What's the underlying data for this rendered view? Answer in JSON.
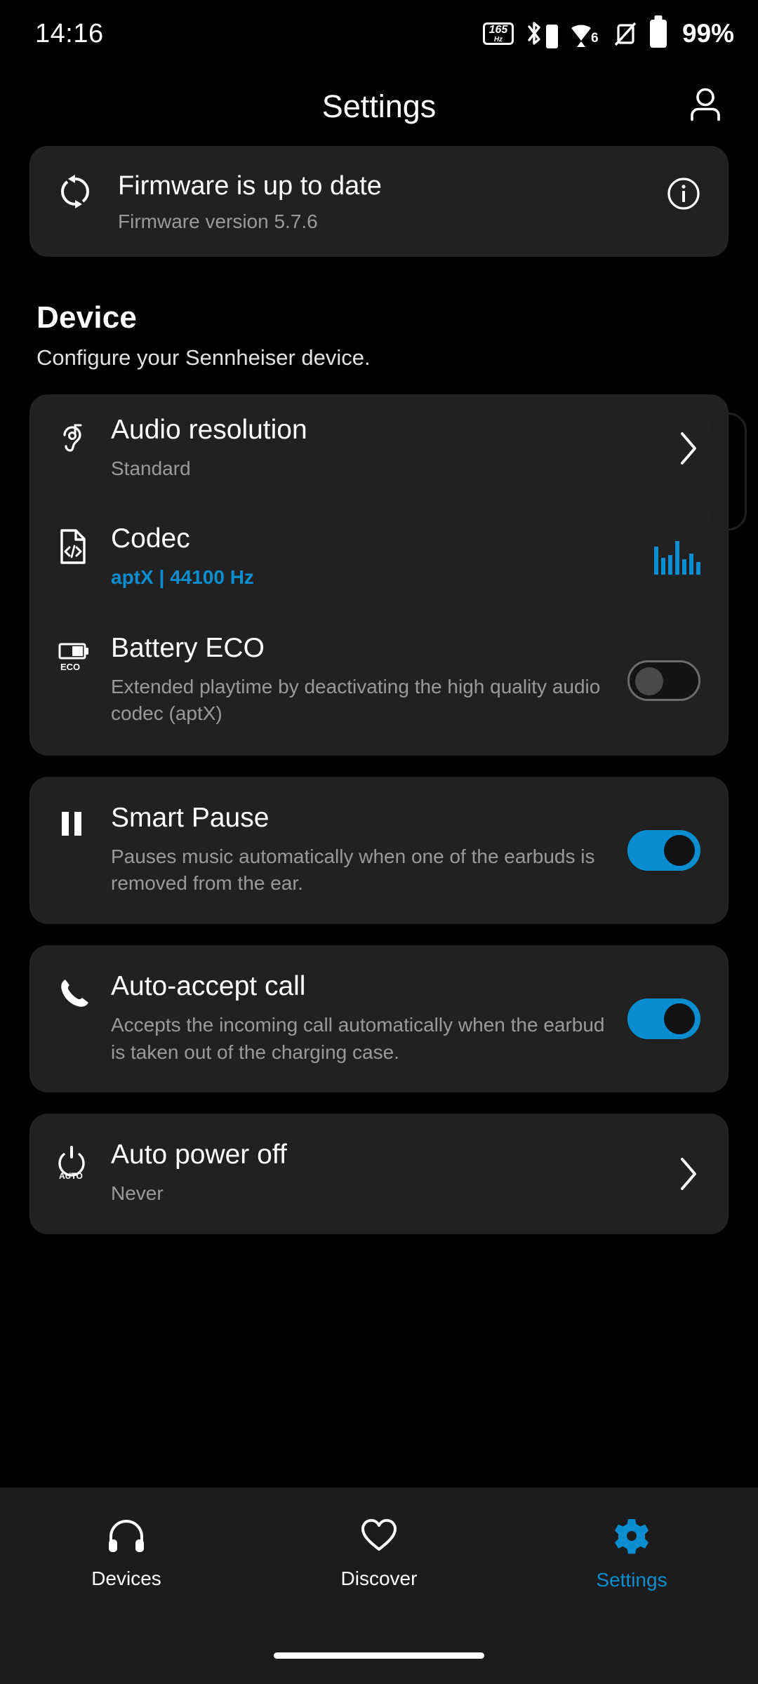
{
  "status_bar": {
    "time": "14:16",
    "refresh_rate_value": "165",
    "refresh_rate_unit": "Hz",
    "battery_percent": "99%",
    "icons": [
      "refresh-rate-icon",
      "bluetooth-icon",
      "bluetooth-battery-icon",
      "wifi-6-icon",
      "vibrate-off-icon",
      "battery-icon"
    ],
    "wifi_generation": "6"
  },
  "header": {
    "title": "Settings",
    "account_icon": "person-icon"
  },
  "firmware_card": {
    "icon": "sync-icon",
    "title": "Firmware is up to date",
    "subtitle": "Firmware version 5.7.6",
    "info_icon": "info-icon"
  },
  "device_section": {
    "title": "Device",
    "subtitle": "Configure your Sennheiser device."
  },
  "device_rows": [
    {
      "icon": "ear-audio-icon",
      "title": "Audio resolution",
      "subtitle": "Standard",
      "control": "chevron"
    },
    {
      "icon": "codec-file-icon",
      "title": "Codec",
      "subtitle": "aptX | 44100 Hz",
      "control": "equalizer"
    },
    {
      "icon": "battery-eco-icon",
      "icon_label": "ECO",
      "title": "Battery ECO",
      "subtitle": "Extended playtime by deactivating the high quality audio codec (aptX)",
      "control": "toggle",
      "toggle_state": "off"
    }
  ],
  "feature_cards": [
    {
      "icon": "pause-icon",
      "title": "Smart Pause",
      "subtitle": "Pauses music automatically when one of the earbuds is removed from the ear.",
      "control": "toggle",
      "toggle_state": "on"
    },
    {
      "icon": "phone-icon",
      "title": "Auto-accept call",
      "subtitle": "Accepts the incoming call automatically when the earbud is taken out of the charging case.",
      "control": "toggle",
      "toggle_state": "on"
    },
    {
      "icon": "auto-power-icon",
      "icon_label": "AUTO",
      "title": "Auto power off",
      "subtitle": "Never",
      "control": "chevron"
    }
  ],
  "bottom_nav": [
    {
      "icon": "headphones-icon",
      "label": "Devices",
      "active": false
    },
    {
      "icon": "heart-icon",
      "label": "Discover",
      "active": false
    },
    {
      "icon": "gear-icon",
      "label": "Settings",
      "active": true
    }
  ],
  "colors": {
    "accent": "#0b8ed0",
    "background": "#000000",
    "card": "#212121",
    "secondary_text": "#9a9a9a"
  }
}
